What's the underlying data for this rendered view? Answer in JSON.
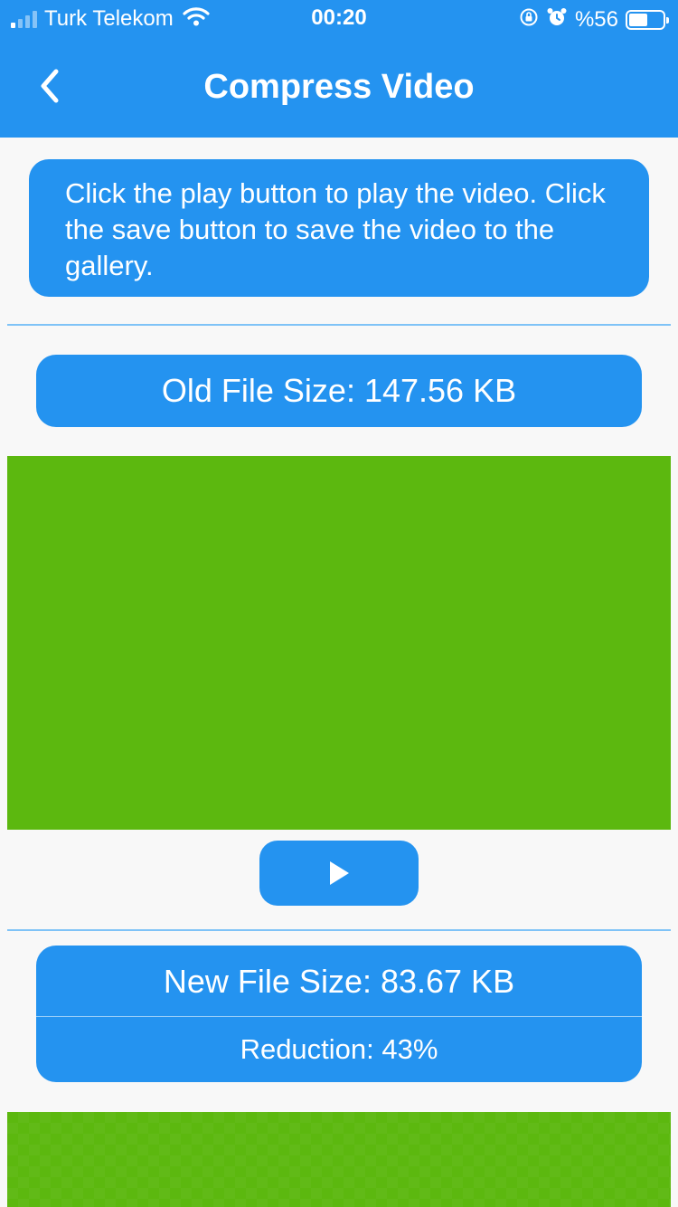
{
  "status_bar": {
    "carrier": "Turk Telekom",
    "time": "00:20",
    "battery": "%56"
  },
  "app_bar": {
    "title": "Compress Video",
    "back_icon": "chevron-left-icon"
  },
  "info": {
    "text": "Click the play button to play the video. Click the save button to save the video to the gallery."
  },
  "old_size": {
    "label": "Old File Size: 147.56 KB"
  },
  "original_video": {
    "color": "#5cb80f"
  },
  "play_button": {
    "icon": "play-icon"
  },
  "new_size": {
    "label": "New File Size: 83.67 KB",
    "reduction": "Reduction: 43%"
  },
  "colors": {
    "primary": "#2493f0",
    "background": "#f8f8f8",
    "divider": "#7fc3f7",
    "video": "#5cb80f"
  }
}
